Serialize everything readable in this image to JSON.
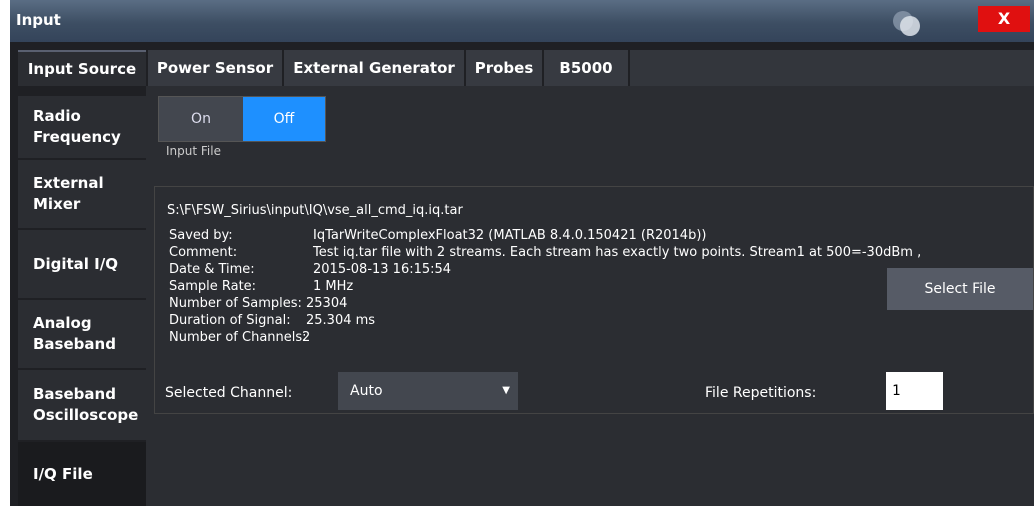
{
  "window": {
    "title": "Input",
    "close_label": "X"
  },
  "tabs": [
    {
      "label": "Input Source",
      "active": true
    },
    {
      "label": "Power Sensor",
      "active": false
    },
    {
      "label": "External Generator",
      "active": false
    },
    {
      "label": "Probes",
      "active": false
    },
    {
      "label": "B5000",
      "active": false
    }
  ],
  "sidebar": {
    "items": [
      {
        "label": "Radio Frequency",
        "active": false
      },
      {
        "label": "External Mixer",
        "active": false
      },
      {
        "label": "Digital I/Q",
        "active": false
      },
      {
        "label": "Analog Baseband",
        "active": false
      },
      {
        "label": "Baseband Oscilloscope",
        "active": false
      },
      {
        "label": "I/Q File",
        "active": true
      }
    ]
  },
  "input_file": {
    "toggle": {
      "on_label": "On",
      "off_label": "Off",
      "selected": "Off"
    },
    "label": "Input File",
    "path": "S:\\F\\FSW_Sirius\\input\\IQ\\vse_all_cmd_iq.iq.tar",
    "select_button": "Select File",
    "details": [
      {
        "label": "Saved by:",
        "value": "IqTarWriteComplexFloat32 (MATLAB 8.4.0.150421 (R2014b))"
      },
      {
        "label": "Comment:",
        "value": "Test iq.tar file with 2 streams. Each stream has exactly two points. Stream1 at 500=-30dBm ,"
      },
      {
        "label": "Date & Time:",
        "value": "2015-08-13 16:15:54"
      },
      {
        "label": "Sample Rate:",
        "value": "1 MHz"
      },
      {
        "label": "Number of Samples:",
        "value": "25304"
      },
      {
        "label": "Duration of Signal:",
        "value": "25.304 ms"
      },
      {
        "label": "Number of Channels:",
        "value": "2"
      }
    ],
    "selected_channel_label": "Selected Channel:",
    "selected_channel_value": "Auto",
    "file_repetitions_label": "File Repetitions:",
    "file_repetitions_value": "1"
  },
  "colors": {
    "accent": "#1e90ff",
    "close": "#e01010",
    "panel": "#2b2d32"
  }
}
